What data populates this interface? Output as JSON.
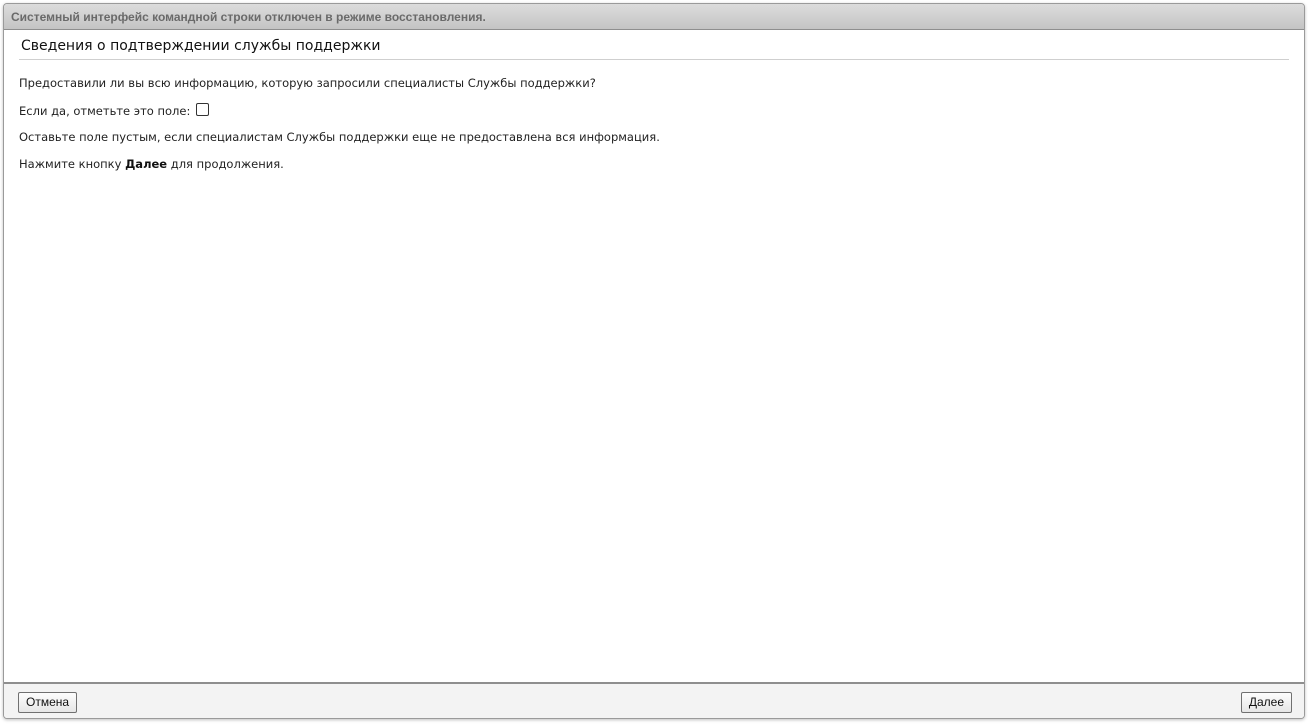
{
  "window": {
    "title_bar": "Системный интерфейс командной строки отключен в режиме восстановления."
  },
  "main": {
    "heading": "Сведения о подтверждении службы поддержки",
    "question": "Предоставили ли вы всю информацию, которую запросили специалисты Службы поддержки?",
    "checkbox_label": "Если да, отметьте это поле:",
    "checkbox_checked": false,
    "leave_empty_text": "Оставьте поле пустым, если специалистам Службы поддержки еще не предоставлена вся информация.",
    "instruction_prefix": "Нажмите кнопку ",
    "instruction_bold": "Далее",
    "instruction_suffix": " для продолжения."
  },
  "footer": {
    "cancel_label": "Отмена",
    "next_label": "Далее"
  }
}
